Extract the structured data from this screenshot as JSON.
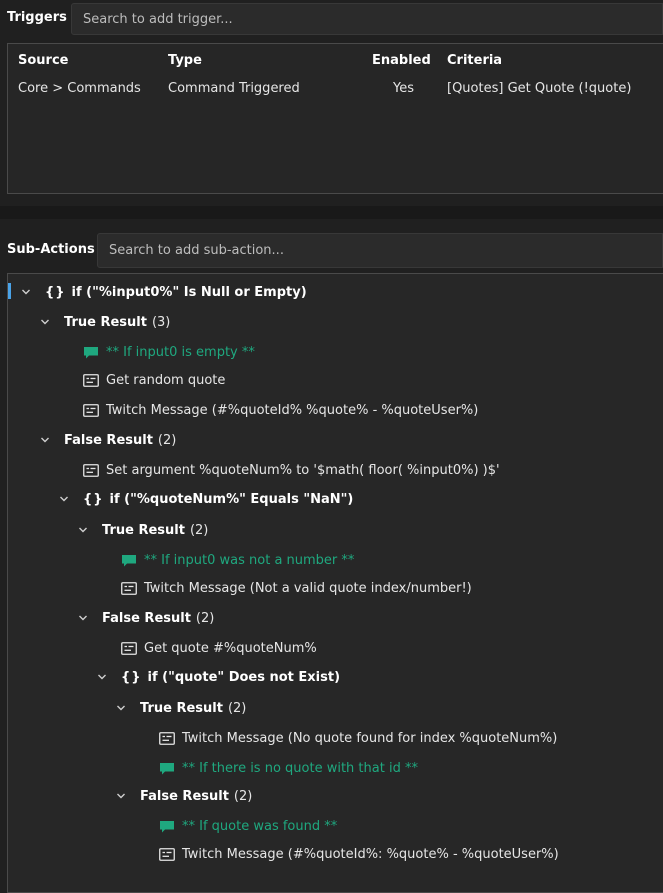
{
  "triggers": {
    "label": "Triggers",
    "search_placeholder": "Search to add trigger...",
    "columns": [
      "Source",
      "Type",
      "Enabled",
      "Criteria"
    ],
    "rows": [
      [
        "Core > Commands",
        "Command Triggered",
        "Yes",
        "[Quotes] Get Quote (!quote)"
      ]
    ]
  },
  "subactions": {
    "label": "Sub-Actions",
    "search_placeholder": "Search to add sub-action...",
    "tree": [
      {
        "kind": "if",
        "text": "if (\"%input0%\" Is Null or Empty)"
      },
      {
        "kind": "result",
        "text": "True Result",
        "count": "(3)"
      },
      {
        "kind": "comment",
        "text": "** If input0 is empty **"
      },
      {
        "kind": "action",
        "text": "Get random quote"
      },
      {
        "kind": "action",
        "text": "Twitch Message (#%quoteId% %quote% - %quoteUser%)"
      },
      {
        "kind": "result",
        "text": "False Result",
        "count": "(2)"
      },
      {
        "kind": "action",
        "text": "Set argument %quoteNum% to '$math( floor( %input0%) )$'"
      },
      {
        "kind": "if",
        "text": "if (\"%quoteNum%\" Equals \"NaN\")"
      },
      {
        "kind": "result",
        "text": "True Result",
        "count": "(2)"
      },
      {
        "kind": "comment",
        "text": "** If input0 was not a number **"
      },
      {
        "kind": "action",
        "text": "Twitch Message (Not a valid quote index/number!)"
      },
      {
        "kind": "result",
        "text": "False Result",
        "count": "(2)"
      },
      {
        "kind": "action",
        "text": "Get quote #%quoteNum%"
      },
      {
        "kind": "if",
        "text": "if (\"quote\" Does not Exist)"
      },
      {
        "kind": "result",
        "text": "True Result",
        "count": "(2)"
      },
      {
        "kind": "action",
        "text": "Twitch Message (No quote found for index %quoteNum%)"
      },
      {
        "kind": "comment",
        "text": "** If there is no quote with that id **"
      },
      {
        "kind": "result",
        "text": "False Result",
        "count": "(2)"
      },
      {
        "kind": "comment",
        "text": "** If quote was found **"
      },
      {
        "kind": "action",
        "text": "Twitch Message (#%quoteId%: %quote% - %quoteUser%)"
      }
    ]
  },
  "colors": {
    "accent": "#4aa3e8",
    "comment": "#1fa87f",
    "background": "#202020"
  },
  "icons": {
    "chevron": "chevron-down-icon",
    "comment": "comment-icon",
    "action": "action-icon",
    "brace": "braces-icon"
  }
}
